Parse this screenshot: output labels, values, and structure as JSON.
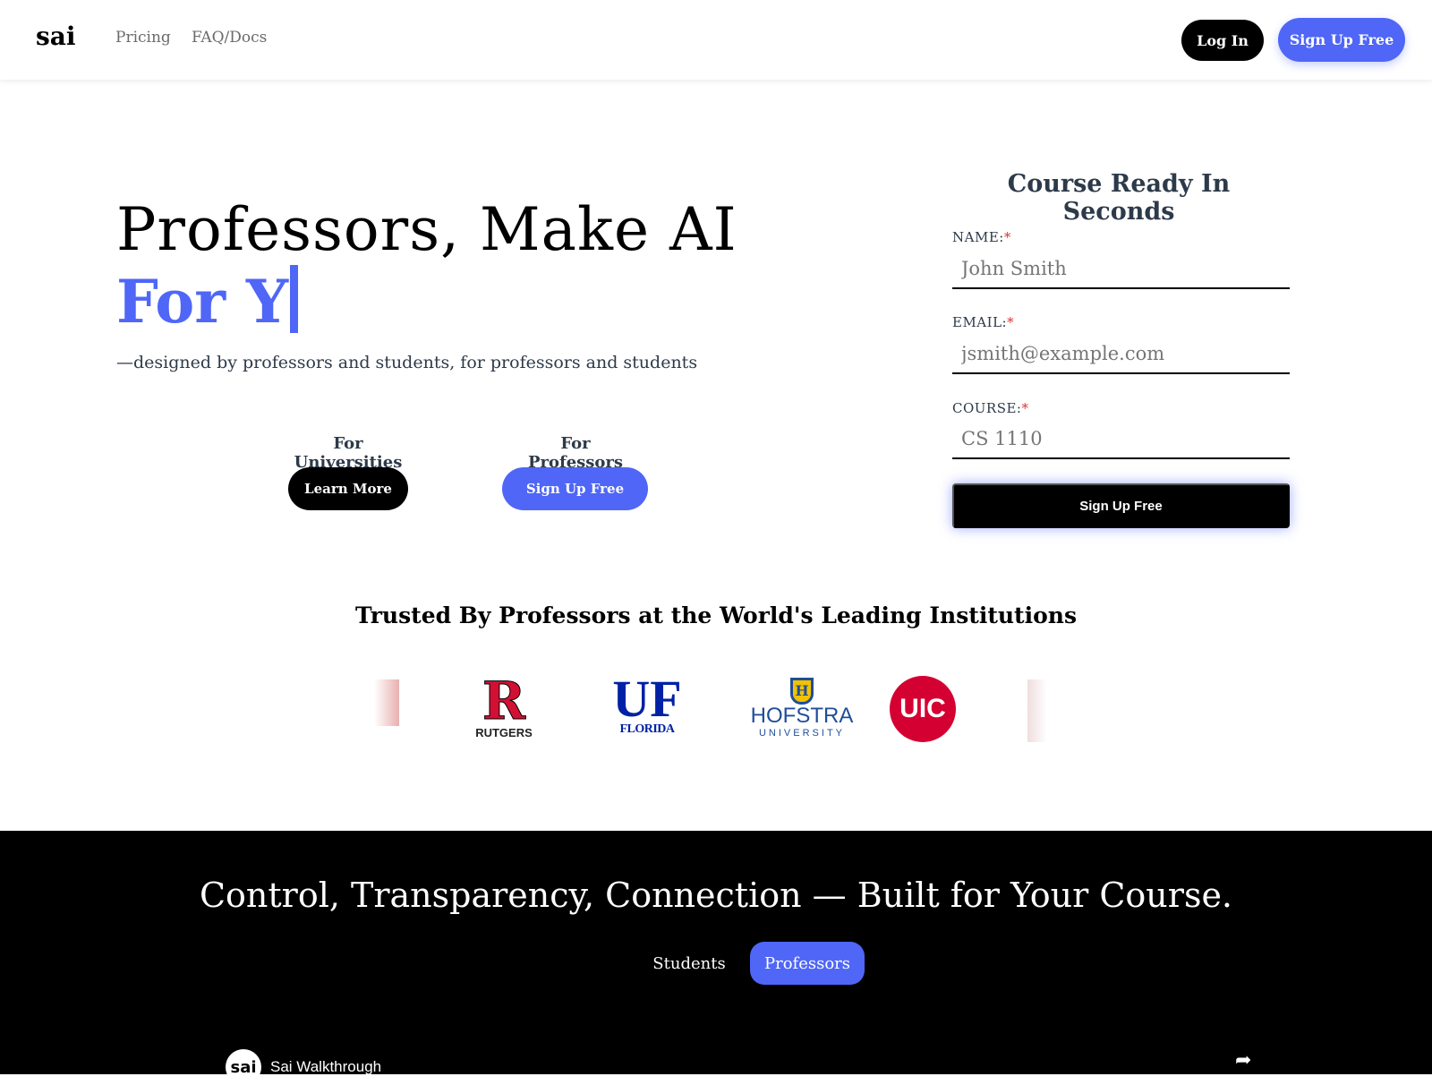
{
  "nav": {
    "logo": "sai",
    "links": [
      "Pricing",
      "FAQ/Docs"
    ],
    "login": "Log In",
    "signup": "Sign Up Free"
  },
  "hero": {
    "line1": "Professors, Make AI",
    "line2": "For Y",
    "subtitle": "—designed by professors and students, for professors and students",
    "universities": {
      "label": "For Universities",
      "button": "Learn More"
    },
    "professors": {
      "label": "For Professors",
      "button": "Sign Up Free"
    }
  },
  "form": {
    "title": "Course Ready In Seconds",
    "required": "*",
    "fields": [
      {
        "label": "NAME:",
        "placeholder": "John Smith"
      },
      {
        "label": "EMAIL:",
        "placeholder": "jsmith@example.com"
      },
      {
        "label": "COURSE:",
        "placeholder": "CS 1110"
      }
    ],
    "submit": "Sign Up Free"
  },
  "trusted": {
    "title": "Trusted By Professors at the World's Leading Institutions",
    "logos": [
      "Rutgers",
      "University of Florida",
      "Hofstra University",
      "UIC"
    ]
  },
  "features": {
    "title": "Control, Transparency, Connection — Built for Your Course.",
    "tabs": [
      "Students",
      "Professors"
    ],
    "active_tab": "Professors"
  },
  "video": {
    "channel": "sai",
    "title": "Sai Walkthrough"
  },
  "colors": {
    "accent": "#4f66f7"
  }
}
